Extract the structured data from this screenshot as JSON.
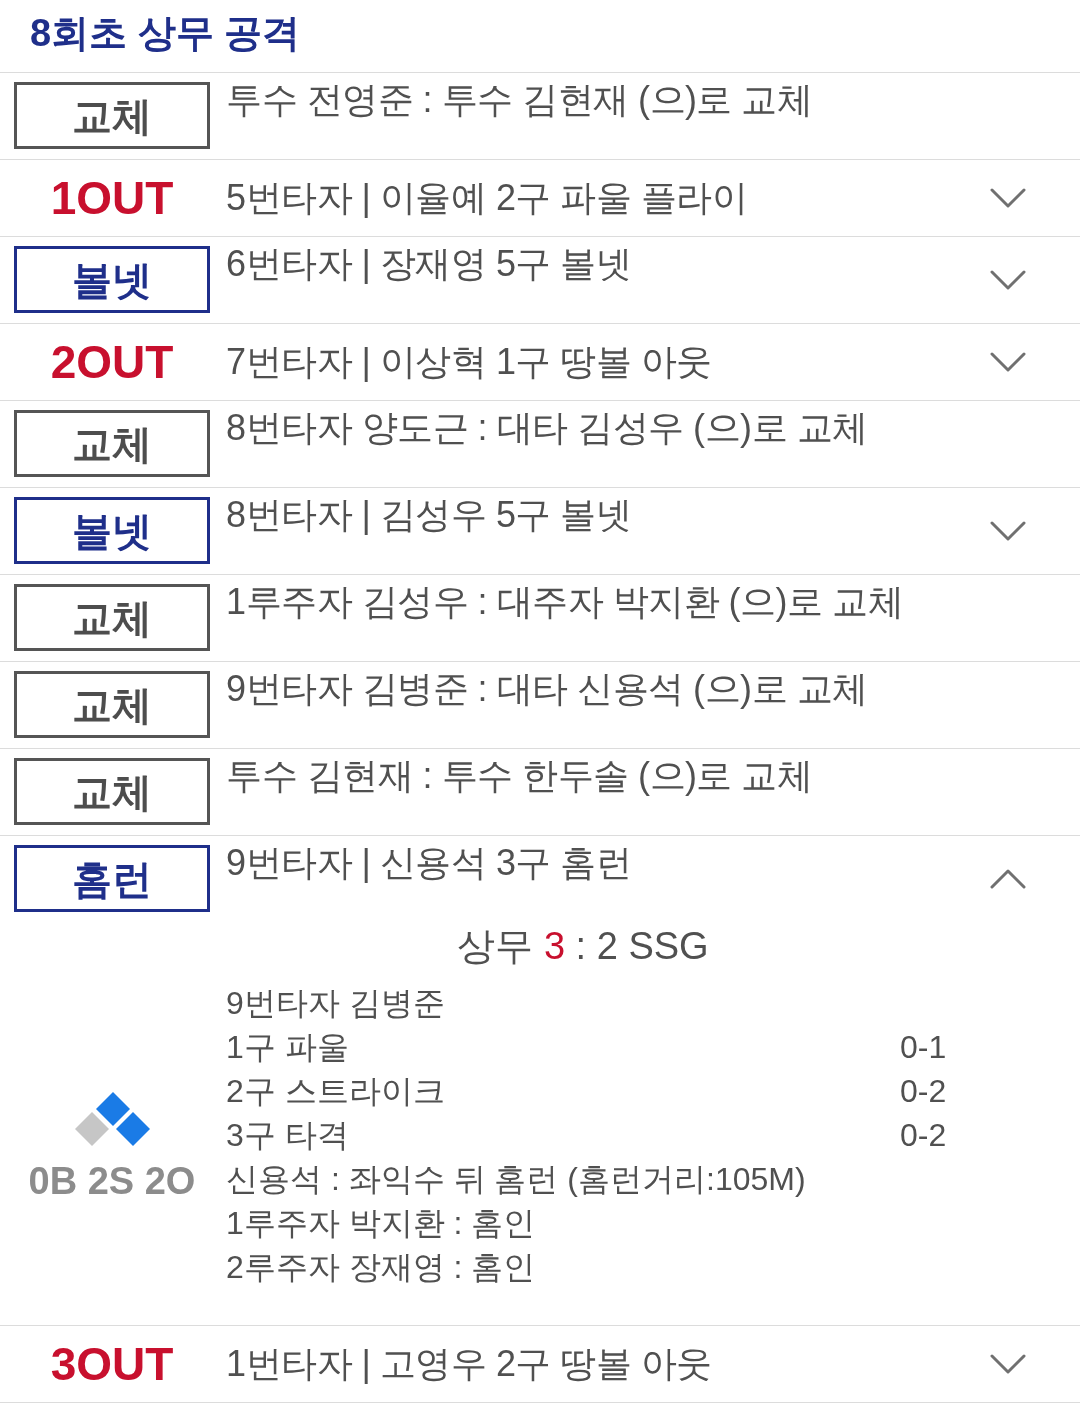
{
  "header": {
    "title": "8회초 상무 공격"
  },
  "events": [
    {
      "kind": "substitution",
      "tag": "교체",
      "text": "투수 전영준 : 투수 김현재 (으)로 교체"
    },
    {
      "kind": "out",
      "tag": "1OUT",
      "text": "5번타자 | 이율예 2구 파울 플라이",
      "expanded": false
    },
    {
      "kind": "play",
      "tag": "볼넷",
      "text": "6번타자 | 장재영 5구 볼넷",
      "expanded": false
    },
    {
      "kind": "out",
      "tag": "2OUT",
      "text": "7번타자 | 이상혁 1구 땅볼 아웃",
      "expanded": false
    },
    {
      "kind": "substitution",
      "tag": "교체",
      "text": "8번타자 양도근 : 대타 김성우 (으)로 교체"
    },
    {
      "kind": "play",
      "tag": "볼넷",
      "text": "8번타자 | 김성우 5구 볼넷",
      "expanded": false
    },
    {
      "kind": "substitution",
      "tag": "교체",
      "text": "1루주자 김성우 : 대주자 박지환 (으)로 교체"
    },
    {
      "kind": "substitution",
      "tag": "교체",
      "text": "9번타자 김병준 : 대타 신용석 (으)로 교체"
    },
    {
      "kind": "substitution",
      "tag": "교체",
      "text": "투수 김현재 : 투수 한두솔 (으)로 교체"
    },
    {
      "kind": "play",
      "tag": "홈런",
      "text": "9번타자 | 신용석 3구 홈런",
      "expanded": true,
      "detail": {
        "score": [
          {
            "text": "상무",
            "highlight": false
          },
          {
            "text": "3",
            "highlight": true
          },
          {
            "text": ":",
            "highlight": false
          },
          {
            "text": "2",
            "highlight": false
          },
          {
            "text": "SSG",
            "highlight": false
          }
        ],
        "bases": {
          "first": true,
          "second": true,
          "third": false
        },
        "count": "0B 2S 2O",
        "lines": [
          {
            "text": "9번타자 김병준"
          },
          {
            "text": "1구 파울",
            "count": "0-1"
          },
          {
            "text": "2구 스트라이크",
            "count": "0-2"
          },
          {
            "text": "3구 타격",
            "count": "0-2"
          },
          {
            "text": "신용석 : 좌익수 뒤 홈런 (홈런거리:105M)"
          },
          {
            "text": "1루주자 박지환 : 홈인"
          },
          {
            "text": "2루주자 장재영 : 홈인"
          }
        ]
      }
    },
    {
      "kind": "out",
      "tag": "3OUT",
      "text": "1번타자 | 고영우 2구 땅볼 아웃",
      "expanded": false
    }
  ]
}
